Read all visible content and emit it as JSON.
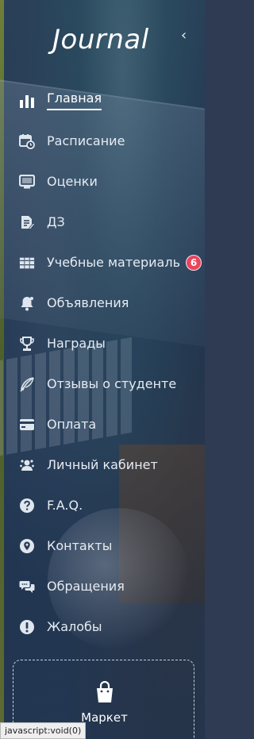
{
  "app": {
    "brand": "Journal",
    "collapse_glyph": "‹"
  },
  "colors": {
    "badge": "#e8455e",
    "text": "#e6ebf2",
    "active_text": "#ffffff"
  },
  "menu": [
    {
      "id": "home",
      "label": "Главная",
      "icon": "bar-chart-icon",
      "active": true
    },
    {
      "id": "schedule",
      "label": "Расписание",
      "icon": "calendar-clock-icon"
    },
    {
      "id": "grades",
      "label": "Оценки",
      "icon": "monitor-icon"
    },
    {
      "id": "homework",
      "label": "ДЗ",
      "icon": "edit-document-icon"
    },
    {
      "id": "materials",
      "label": "Учебные материаль",
      "icon": "books-icon",
      "badge": "6"
    },
    {
      "id": "announcements",
      "label": "Объявления",
      "icon": "bell-icon"
    },
    {
      "id": "awards",
      "label": "Награды",
      "icon": "trophy-icon"
    },
    {
      "id": "reviews",
      "label": "Отзывы о студенте",
      "icon": "feather-icon"
    },
    {
      "id": "payment",
      "label": "Оплата",
      "icon": "card-icon"
    },
    {
      "id": "cabinet",
      "label": "Личный кабинет",
      "icon": "user-gear-icon"
    },
    {
      "id": "faq",
      "label": "F.A.Q.",
      "icon": "question-icon"
    },
    {
      "id": "contacts",
      "label": "Контакты",
      "icon": "location-pin-icon"
    },
    {
      "id": "requests",
      "label": "Обращения",
      "icon": "chat-bubbles-icon"
    },
    {
      "id": "complaints",
      "label": "Жалобы",
      "icon": "exclamation-icon"
    }
  ],
  "market": {
    "label": "Маркет",
    "icon": "shopping-bag-icon"
  },
  "statusbar": {
    "text": "javascript:void(0)"
  }
}
